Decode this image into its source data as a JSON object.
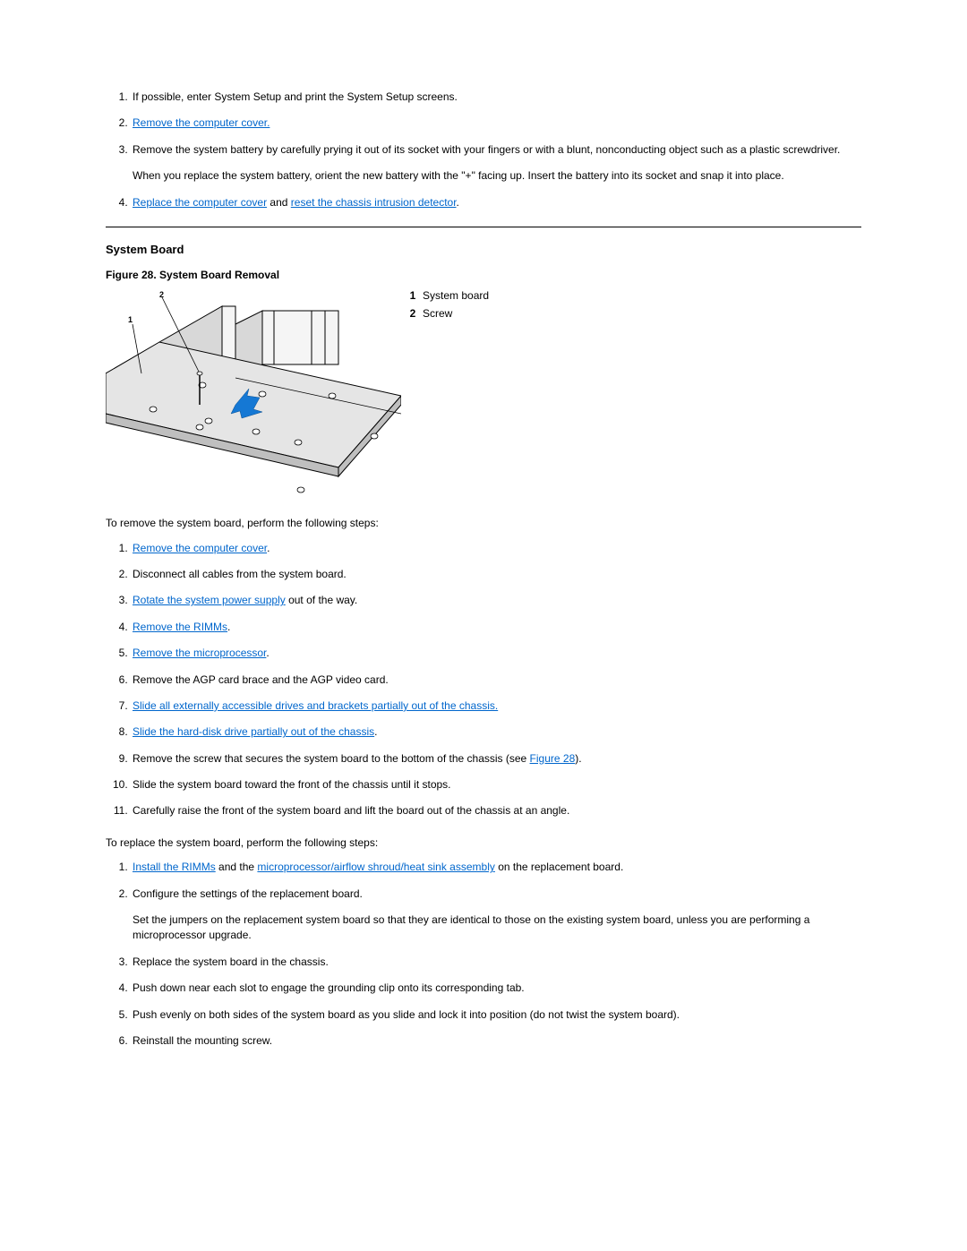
{
  "battery_steps": {
    "s1": "If possible, enter System Setup and print the System Setup screens.",
    "s2_link": "Remove the computer cover.",
    "s3": "Remove the system battery by carefully prying it out of its socket with your fingers or with a blunt, nonconducting object such as a plastic screwdriver.",
    "s3b": "When you replace the system battery, orient the new battery with the \"+\" facing up. Insert the battery into its socket and snap it into place.",
    "s4_link1": "Replace the computer cover",
    "s4_mid": " and ",
    "s4_link2": "reset the chassis intrusion detector",
    "s4_end": "."
  },
  "section_title": "System Board",
  "figure_caption": "Figure 28. System Board Removal",
  "legend": {
    "n1": "1",
    "l1": "System board",
    "n2": "2",
    "l2": "Screw"
  },
  "remove_intro": "To remove the system board, perform the following steps:",
  "remove": {
    "s1_link": "Remove the computer cover",
    "s1_end": ".",
    "s2": "Disconnect all cables from the system board.",
    "s3_link": "Rotate the system power supply",
    "s3_end": " out of the way.",
    "s4_link": "Remove the RIMMs",
    "s4_end": ".",
    "s5_link": "Remove the microprocessor",
    "s5_end": ".",
    "s6": "Remove the AGP card brace and the AGP video card.",
    "s7_link": "Slide all externally accessible drives and brackets partially out of the chassis.",
    "s8_link": "Slide the hard-disk drive partially out of the chassis",
    "s8_end": ".",
    "s9a": "Remove the screw that secures the system board to the bottom of the chassis (see ",
    "s9_link": "Figure 28",
    "s9b": ").",
    "s10": "Slide the system board toward the front of the chassis until it stops.",
    "s11": "Carefully raise the front of the system board and lift the board out of the chassis at an angle."
  },
  "replace_intro": "To replace the system board, perform the following steps:",
  "replace": {
    "s1_link1": "Install the RIMMs",
    "s1_mid": " and the ",
    "s1_link2": "microprocessor/airflow shroud/heat sink assembly",
    "s1_end": " on the replacement board.",
    "s2": "Configure the settings of the replacement board.",
    "s2b": "Set the jumpers on the replacement system board so that they are identical to those on the existing system board, unless you are performing a microprocessor upgrade.",
    "s3": "Replace the system board in the chassis.",
    "s4": "Push down near each slot to engage the grounding clip onto its corresponding tab.",
    "s5": "Push evenly on both sides of the system board as you slide and lock it into position (do not twist the system board).",
    "s6": "Reinstall the mounting screw."
  }
}
